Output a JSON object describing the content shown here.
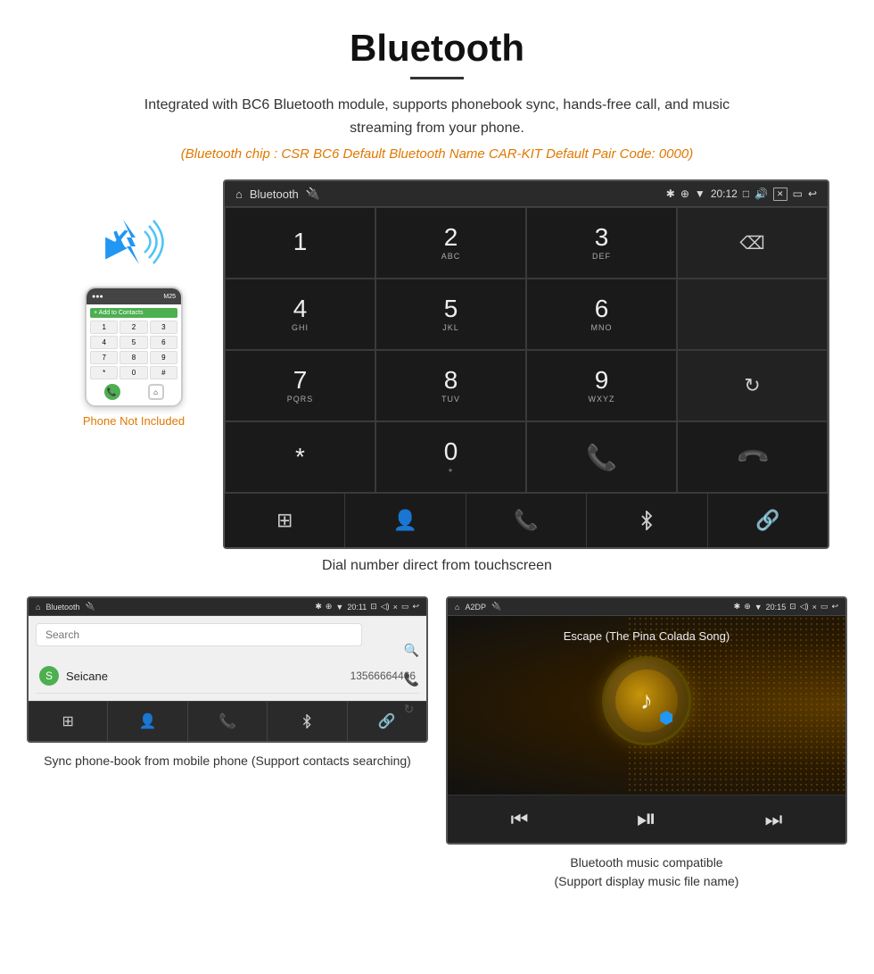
{
  "title": "Bluetooth",
  "subtitle": "Integrated with BC6 Bluetooth module, supports phonebook sync, hands-free call, and music streaming from your phone.",
  "specs": "(Bluetooth chip : CSR BC6    Default Bluetooth Name CAR-KIT    Default Pair Code: 0000)",
  "dial_screen": {
    "status_bar": {
      "app_name": "Bluetooth",
      "time": "20:12"
    },
    "keys": [
      {
        "number": "1",
        "letters": ""
      },
      {
        "number": "2",
        "letters": "ABC"
      },
      {
        "number": "3",
        "letters": "DEF"
      },
      {
        "number": "",
        "letters": ""
      },
      {
        "number": "4",
        "letters": "GHI"
      },
      {
        "number": "5",
        "letters": "JKL"
      },
      {
        "number": "6",
        "letters": "MNO"
      },
      {
        "number": "",
        "letters": ""
      },
      {
        "number": "7",
        "letters": "PQRS"
      },
      {
        "number": "8",
        "letters": "TUV"
      },
      {
        "number": "9",
        "letters": "WXYZ"
      },
      {
        "number": "",
        "letters": ""
      },
      {
        "number": "*",
        "letters": ""
      },
      {
        "number": "0",
        "letters": "+"
      },
      {
        "number": "#",
        "letters": ""
      },
      {
        "number": "",
        "letters": ""
      }
    ],
    "toolbar_icons": [
      "grid",
      "person",
      "phone",
      "bluetooth",
      "link"
    ]
  },
  "dial_caption": "Dial number direct from touchscreen",
  "phonebook_screen": {
    "status_bar": {
      "app_name": "Bluetooth",
      "time": "20:11"
    },
    "search_placeholder": "Search",
    "contacts": [
      {
        "letter": "S",
        "name": "Seicane",
        "number": "13566664466"
      }
    ],
    "toolbar_icons": [
      "grid",
      "person",
      "phone",
      "bluetooth",
      "link"
    ]
  },
  "phonebook_caption": "Sync phone-book from mobile phone\n(Support contacts searching)",
  "music_screen": {
    "status_bar": {
      "app_name": "A2DP",
      "time": "20:15"
    },
    "song_title": "Escape (The Pina Colada Song)"
  },
  "music_caption": "Bluetooth music compatible\n(Support display music file name)",
  "phone_not_included": "Phone Not Included"
}
